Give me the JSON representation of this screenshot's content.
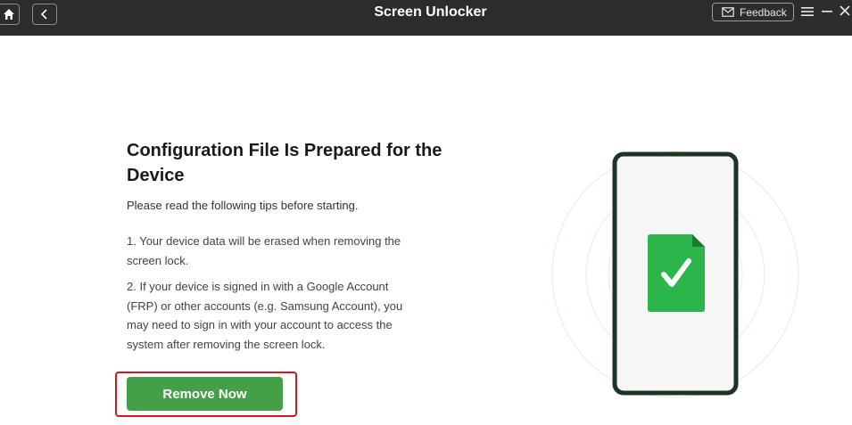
{
  "window": {
    "title": "Screen Unlocker",
    "feedback_label": "Feedback"
  },
  "content": {
    "heading": "Configuration File Is Prepared for the Device",
    "intro": "Please read the following tips before starting.",
    "tips": [
      "1. Your device data will be erased when removing the screen lock.",
      "2. If your device is signed in with a Google Account (FRP) or other accounts (e.g. Samsung Account), you may need to sign in with your account to access the system after removing the screen lock."
    ],
    "primary_button": "Remove Now"
  },
  "icons": {
    "home": "home-icon",
    "back": "chevron-left-icon",
    "feedback": "mail-icon",
    "menu": "hamburger-icon",
    "minimize": "minimize-icon",
    "close": "close-icon",
    "illustration": "phone-with-file-check-icon"
  },
  "colors": {
    "titlebar": "#2b2c2e",
    "primary_green": "#43a047",
    "highlight_red": "#d8141e",
    "file_green": "#2cb54a",
    "phone_frame": "#1d3324"
  }
}
